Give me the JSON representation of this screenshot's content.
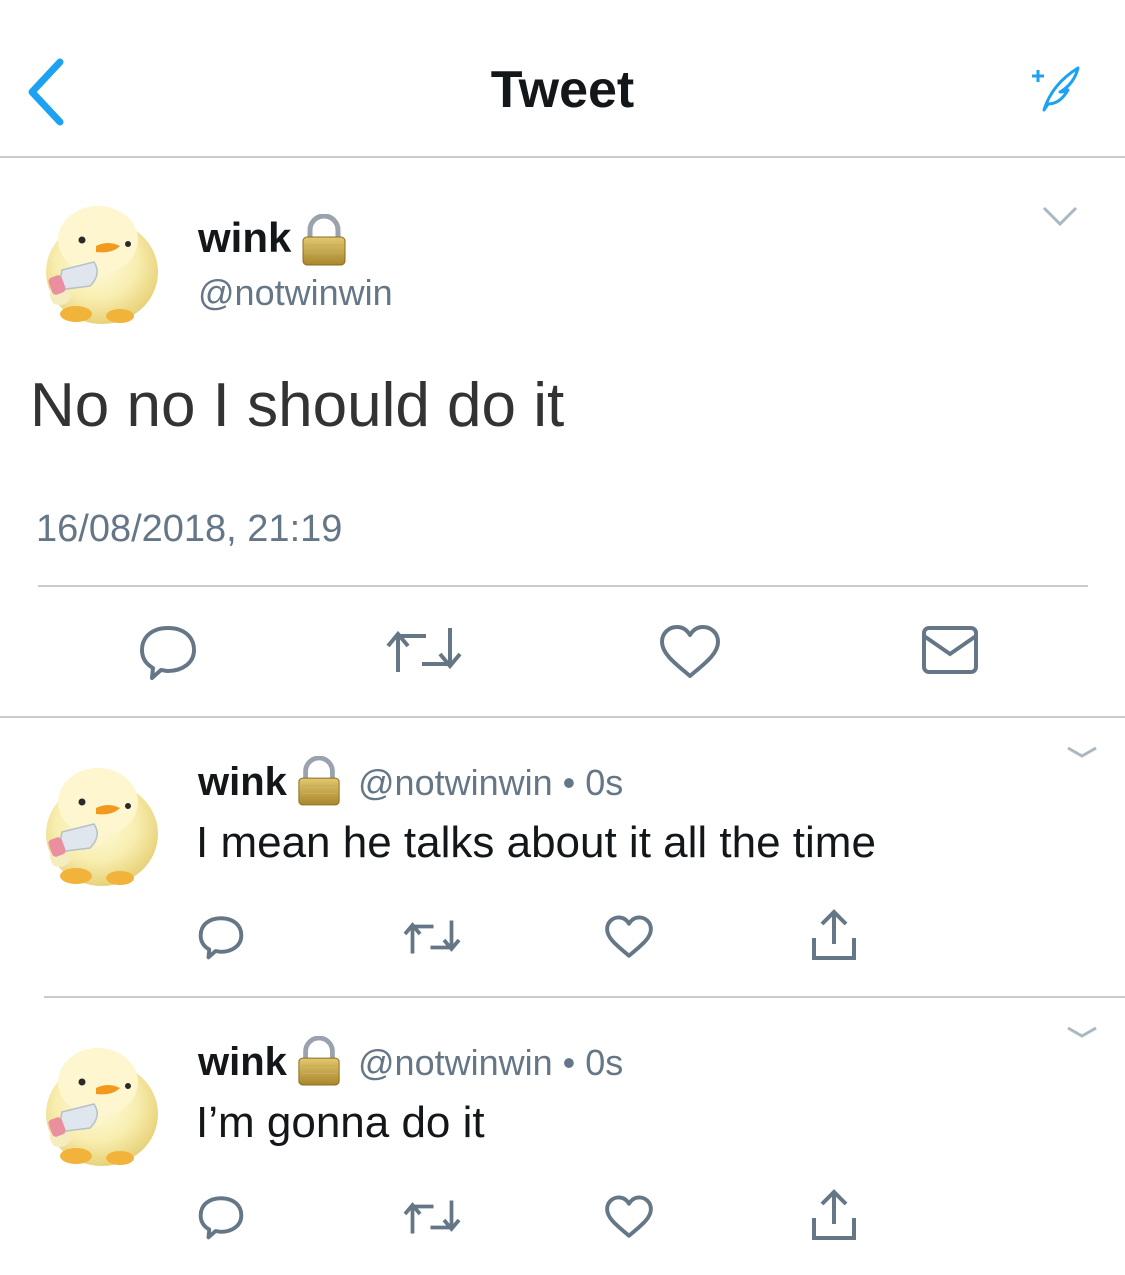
{
  "header": {
    "title": "Tweet",
    "back_icon": "chevron-left-icon",
    "compose_icon": "compose-tweet-icon",
    "accent": "#1da1f2"
  },
  "main_tweet": {
    "name": "wink",
    "lock_icon": "lock-icon",
    "handle": "@notwinwin",
    "text": "No no I should do it",
    "timestamp": "16/08/2018, 21:19",
    "actions": [
      "reply-icon",
      "retweet-icon",
      "like-icon",
      "dm-icon"
    ]
  },
  "replies": [
    {
      "name": "wink",
      "handle": "@notwinwin",
      "separator": "•",
      "time": "0s",
      "text": "I mean he talks about it all the time",
      "actions": [
        "reply-icon",
        "retweet-icon",
        "like-icon",
        "share-icon"
      ]
    },
    {
      "name": "wink",
      "handle": "@notwinwin",
      "separator": "•",
      "time": "0s",
      "text": "I’m gonna do it",
      "actions": [
        "reply-icon",
        "retweet-icon",
        "like-icon",
        "share-icon"
      ]
    }
  ]
}
